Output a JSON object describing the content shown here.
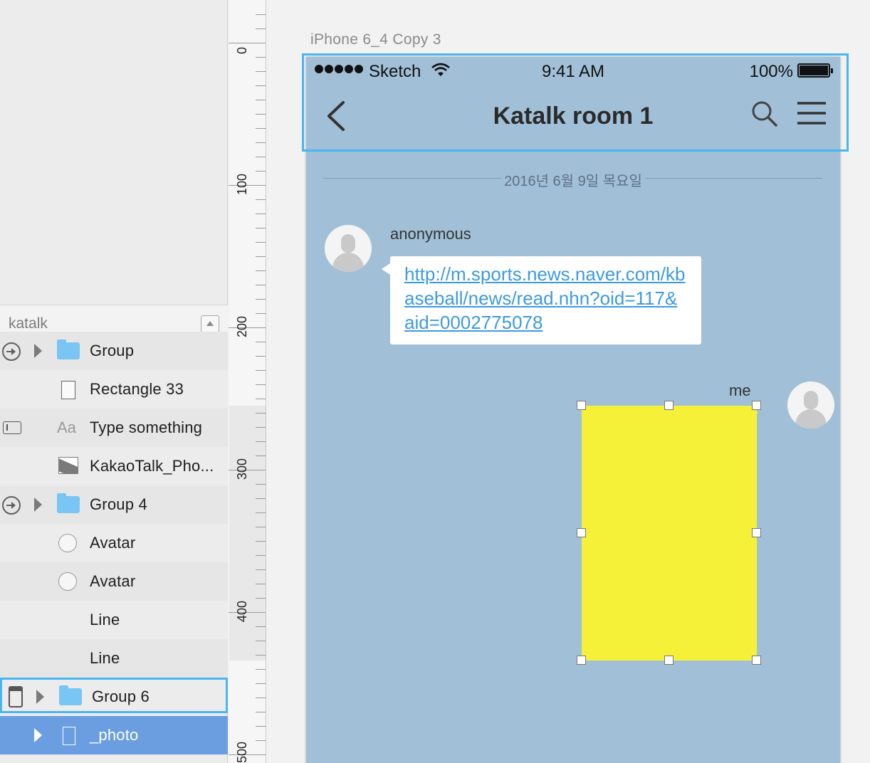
{
  "layers_panel": {
    "title": "katalk",
    "layers": [
      {
        "label": "Group",
        "icon": "folder-icon",
        "symbol": "symbol-arrow-icon",
        "expandable": true
      },
      {
        "label": "Rectangle 33",
        "icon": "rectangle-icon"
      },
      {
        "label": "Type something",
        "icon": "text-layer-icon",
        "symbol": "textfield-icon"
      },
      {
        "label": "KakaoTalk_Pho...",
        "icon": "image-layer-icon"
      },
      {
        "label": "Group 4",
        "icon": "folder-icon",
        "symbol": "symbol-arrow-icon",
        "expandable": true
      },
      {
        "label": "Avatar",
        "icon": "oval-icon"
      },
      {
        "label": "Avatar",
        "icon": "oval-icon"
      },
      {
        "label": "Line"
      },
      {
        "label": "Line"
      },
      {
        "label": "Group 6",
        "icon": "folder-icon",
        "symbol": "device-icon",
        "expandable": true,
        "state": "hover-outline"
      },
      {
        "label": "_photo",
        "icon": "rectangle-icon",
        "expandable": true,
        "state": "selected"
      }
    ]
  },
  "ruler": {
    "labels": [
      "0",
      "100",
      "200",
      "300",
      "400",
      "500"
    ]
  },
  "artboard": {
    "name": "iPhone 6_4 Copy 3",
    "status_bar": {
      "carrier": "Sketch",
      "time": "9:41 AM",
      "battery": "100%"
    },
    "nav": {
      "title": "Katalk room 1"
    },
    "date_divider": "2016년 6월 9일 목요일",
    "messages": [
      {
        "sender": "anonymous",
        "text": "http://m.sports.news.naver.com/kbaseball/news/read.nhn?oid=117&aid=0002775078"
      },
      {
        "sender": "me",
        "type": "photo"
      }
    ]
  },
  "colors": {
    "artboard_bg": "#a1c0d8",
    "selection_outline": "#4ab6ef",
    "selected_row": "#6a9ee0",
    "photo_fill": "#f5f038",
    "link": "#3d9ae0",
    "folder": "#79c5f3"
  }
}
